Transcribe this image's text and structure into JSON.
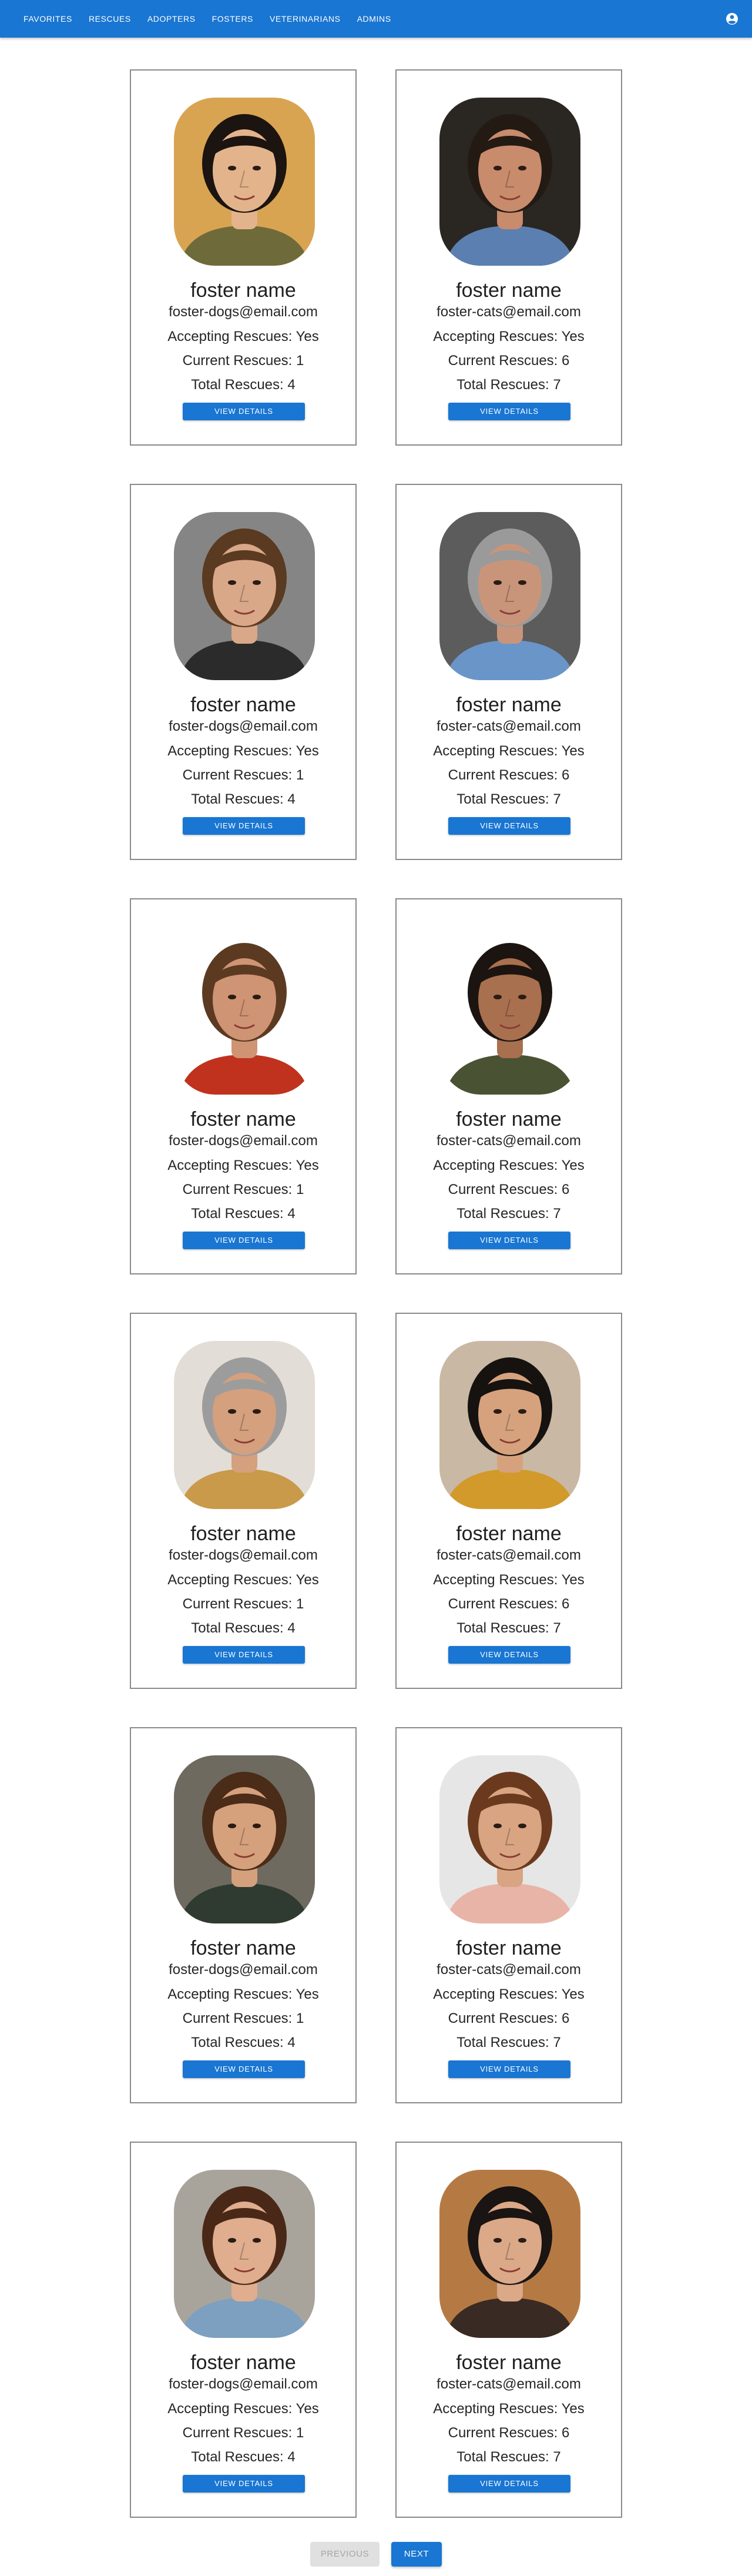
{
  "nav": {
    "items": [
      {
        "label": "FAVORITES"
      },
      {
        "label": "RESCUES"
      },
      {
        "label": "ADOPTERS"
      },
      {
        "label": "FOSTERS"
      },
      {
        "label": "VETERINARIANS"
      },
      {
        "label": "ADMINS"
      }
    ],
    "account_icon": "account-circle-icon"
  },
  "fosters": [
    {
      "name": "foster name",
      "email": "foster-dogs@email.com",
      "accepting": "Accepting Rescues: Yes",
      "current": "Current Rescues: 1",
      "total": "Total Rescues: 4",
      "button": "VIEW DETAILS",
      "photo": {
        "bg": "#d9a452",
        "skin": "#e3b48c",
        "hair": "#1b1410",
        "shirt": "#6f6a3a"
      }
    },
    {
      "name": "foster name",
      "email": "foster-cats@email.com",
      "accepting": "Accepting Rescues: Yes",
      "current": "Current Rescues: 6",
      "total": "Total Rescues: 7",
      "button": "VIEW DETAILS",
      "photo": {
        "bg": "#2a2622",
        "skin": "#c88b6c",
        "hair": "#231a14",
        "shirt": "#5b7fb0"
      }
    },
    {
      "name": "foster name",
      "email": "foster-dogs@email.com",
      "accepting": "Accepting Rescues: Yes",
      "current": "Current Rescues: 1",
      "total": "Total Rescues: 4",
      "button": "VIEW DETAILS",
      "photo": {
        "bg": "#858585",
        "skin": "#d9a889",
        "hair": "#5a3a20",
        "shirt": "#2b2b2b"
      }
    },
    {
      "name": "foster name",
      "email": "foster-cats@email.com",
      "accepting": "Accepting Rescues: Yes",
      "current": "Current Rescues: 6",
      "total": "Total Rescues: 7",
      "button": "VIEW DETAILS",
      "photo": {
        "bg": "#5c5c5c",
        "skin": "#c9957a",
        "hair": "#9a9a9a",
        "shirt": "#6a95c8"
      }
    },
    {
      "name": "foster name",
      "email": "foster-dogs@email.com",
      "accepting": "Accepting Rescues: Yes",
      "current": "Current Rescues: 1",
      "total": "Total Rescues: 4",
      "button": "VIEW DETAILS",
      "photo": {
        "bg": "#ffffff",
        "skin": "#cf9474",
        "hair": "#5c3a22",
        "shirt": "#c0321e"
      }
    },
    {
      "name": "foster name",
      "email": "foster-cats@email.com",
      "accepting": "Accepting Rescues: Yes",
      "current": "Current Rescues: 6",
      "total": "Total Rescues: 7",
      "button": "VIEW DETAILS",
      "photo": {
        "bg": "#ffffff",
        "skin": "#a8704f",
        "hair": "#1c1410",
        "shirt": "#4a5234"
      }
    },
    {
      "name": "foster name",
      "email": "foster-dogs@email.com",
      "accepting": "Accepting Rescues: Yes",
      "current": "Current Rescues: 1",
      "total": "Total Rescues: 4",
      "button": "VIEW DETAILS",
      "photo": {
        "bg": "#e2ddd6",
        "skin": "#d4a07e",
        "hair": "#9c9c9c",
        "shirt": "#c89a4a"
      }
    },
    {
      "name": "foster name",
      "email": "foster-cats@email.com",
      "accepting": "Accepting Rescues: Yes",
      "current": "Current Rescues: 6",
      "total": "Total Rescues: 7",
      "button": "VIEW DETAILS",
      "photo": {
        "bg": "#c9b8a4",
        "skin": "#d6a27e",
        "hair": "#161210",
        "shirt": "#d29a2a"
      }
    },
    {
      "name": "foster name",
      "email": "foster-dogs@email.com",
      "accepting": "Accepting Rescues: Yes",
      "current": "Current Rescues: 1",
      "total": "Total Rescues: 4",
      "button": "VIEW DETAILS",
      "photo": {
        "bg": "#6e6a60",
        "skin": "#d5a07c",
        "hair": "#4a2c18",
        "shirt": "#2f3a30"
      }
    },
    {
      "name": "foster name",
      "email": "foster-cats@email.com",
      "accepting": "Accepting Rescues: Yes",
      "current": "Current Rescues: 6",
      "total": "Total Rescues: 7",
      "button": "VIEW DETAILS",
      "photo": {
        "bg": "#e6e6e6",
        "skin": "#d9a482",
        "hair": "#6b3a1e",
        "shirt": "#e8b4a8"
      }
    },
    {
      "name": "foster name",
      "email": "foster-dogs@email.com",
      "accepting": "Accepting Rescues: Yes",
      "current": "Current Rescues: 1",
      "total": "Total Rescues: 4",
      "button": "VIEW DETAILS",
      "photo": {
        "bg": "#a8a49c",
        "skin": "#e0ad8e",
        "hair": "#4a2818",
        "shirt": "#7da0c0"
      }
    },
    {
      "name": "foster name",
      "email": "foster-cats@email.com",
      "accepting": "Accepting Rescues: Yes",
      "current": "Current Rescues: 6",
      "total": "Total Rescues: 7",
      "button": "VIEW DETAILS",
      "photo": {
        "bg": "#b57a44",
        "skin": "#dba888",
        "hair": "#1a1412",
        "shirt": "#3a2a24"
      }
    }
  ],
  "pagination": {
    "previous_label": "PREVIOUS",
    "next_label": "NEXT"
  }
}
